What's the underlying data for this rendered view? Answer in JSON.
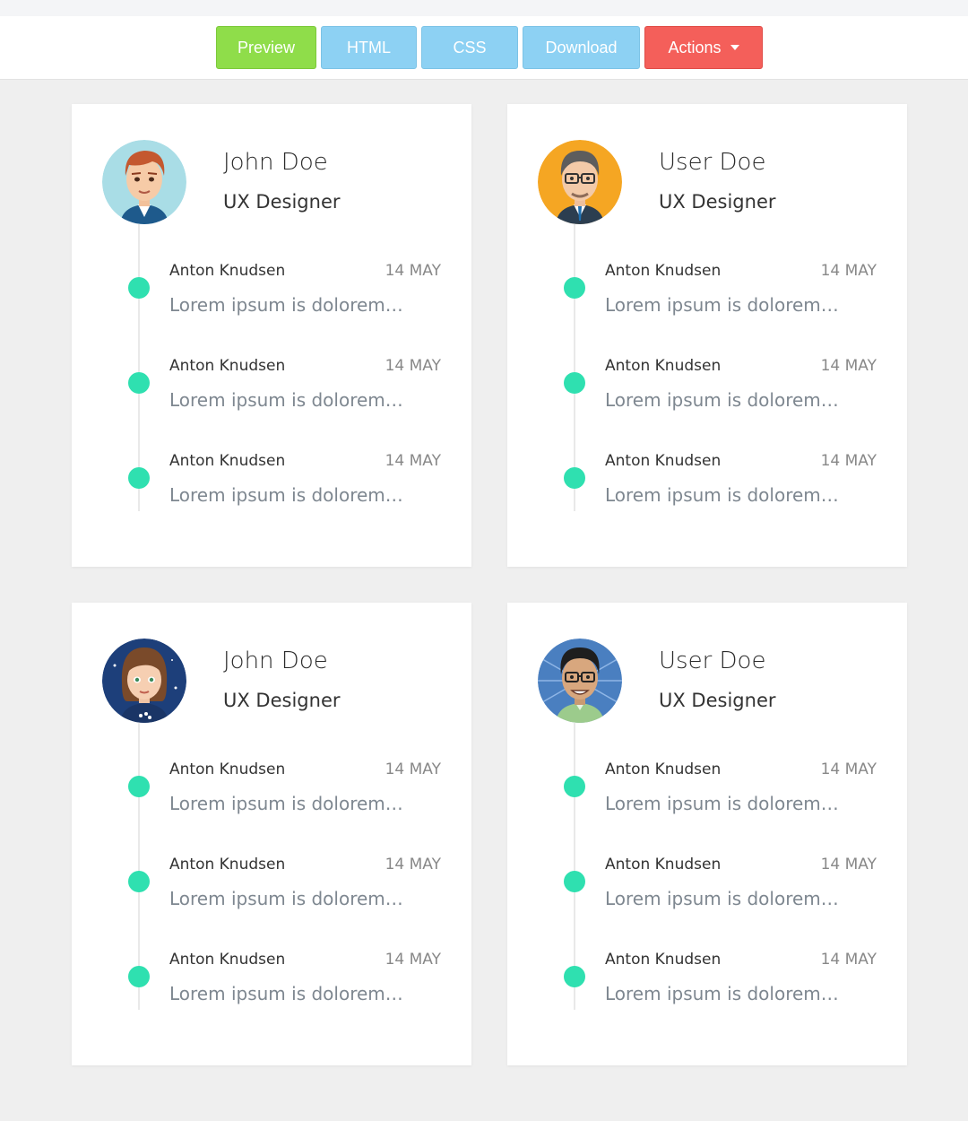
{
  "toolbar": {
    "preview_label": "Preview",
    "html_label": "HTML",
    "css_label": "CSS",
    "download_label": "Download",
    "actions_label": "Actions"
  },
  "colors": {
    "preview": "#8fdd4a",
    "tab": "#8dd1f3",
    "actions": "#f45f5a",
    "timeline_dot": "#2fe0b0",
    "background": "#efefef"
  },
  "cards": [
    {
      "name": "John Doe",
      "role": "UX Designer",
      "avatar_icon": "avatar-redhead-man-icon",
      "entries": [
        {
          "author": "Anton Knudsen",
          "date": "14 MAY",
          "text": "Lorem ipsum is dolorem…"
        },
        {
          "author": "Anton Knudsen",
          "date": "14 MAY",
          "text": "Lorem ipsum is dolorem…"
        },
        {
          "author": "Anton Knudsen",
          "date": "14 MAY",
          "text": "Lorem ipsum is dolorem…"
        }
      ]
    },
    {
      "name": "User Doe",
      "role": "UX Designer",
      "avatar_icon": "avatar-glasses-man-icon",
      "entries": [
        {
          "author": "Anton Knudsen",
          "date": "14 MAY",
          "text": "Lorem ipsum is dolorem…"
        },
        {
          "author": "Anton Knudsen",
          "date": "14 MAY",
          "text": "Lorem ipsum is dolorem…"
        },
        {
          "author": "Anton Knudsen",
          "date": "14 MAY",
          "text": "Lorem ipsum is dolorem…"
        }
      ]
    },
    {
      "name": "John Doe",
      "role": "UX Designer",
      "avatar_icon": "avatar-woman-icon",
      "entries": [
        {
          "author": "Anton Knudsen",
          "date": "14 MAY",
          "text": "Lorem ipsum is dolorem…"
        },
        {
          "author": "Anton Knudsen",
          "date": "14 MAY",
          "text": "Lorem ipsum is dolorem…"
        },
        {
          "author": "Anton Knudsen",
          "date": "14 MAY",
          "text": "Lorem ipsum is dolorem…"
        }
      ]
    },
    {
      "name": "User Doe",
      "role": "UX Designer",
      "avatar_icon": "avatar-dark-hair-man-icon",
      "entries": [
        {
          "author": "Anton Knudsen",
          "date": "14 MAY",
          "text": "Lorem ipsum is dolorem…"
        },
        {
          "author": "Anton Knudsen",
          "date": "14 MAY",
          "text": "Lorem ipsum is dolorem…"
        },
        {
          "author": "Anton Knudsen",
          "date": "14 MAY",
          "text": "Lorem ipsum is dolorem…"
        }
      ]
    }
  ]
}
